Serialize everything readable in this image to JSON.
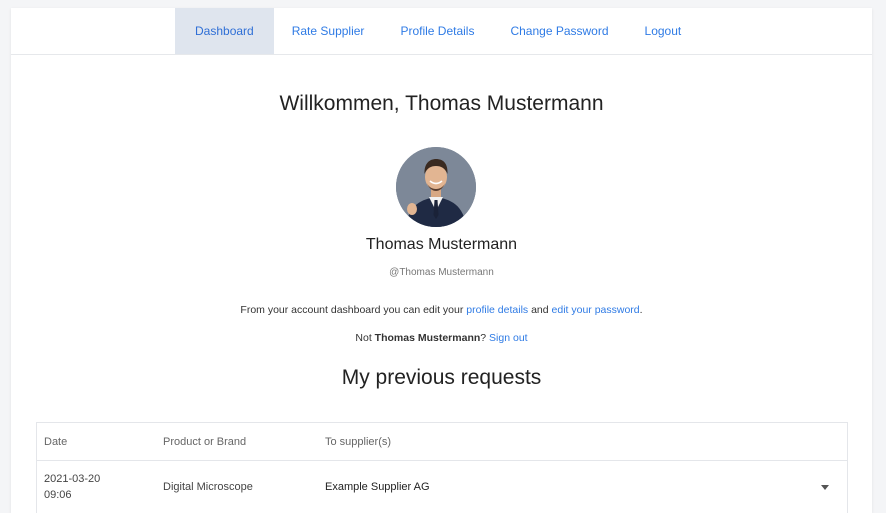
{
  "nav": {
    "items": [
      {
        "label": "Dashboard",
        "active": true
      },
      {
        "label": "Rate Supplier",
        "active": false
      },
      {
        "label": "Profile Details",
        "active": false
      },
      {
        "label": "Change Password",
        "active": false
      },
      {
        "label": "Logout",
        "active": false
      }
    ]
  },
  "welcome": "Willkommen, Thomas Mustermann",
  "profile": {
    "name": "Thomas Mustermann",
    "handle": "@Thomas Mustermann"
  },
  "info": {
    "prefix": "From your account dashboard you can edit your ",
    "profile_link": "profile details",
    "and": " and ",
    "password_link": "edit your password",
    "suffix": "."
  },
  "signout": {
    "prefix": "Not ",
    "name": "Thomas Mustermann",
    "question": "? ",
    "link": "Sign out"
  },
  "requests": {
    "title": "My previous requests",
    "columns": [
      "Date",
      "Product or Brand",
      "To supplier(s)"
    ],
    "rows": [
      {
        "date_line1": "2021-03-20",
        "date_line2": "09:06",
        "product": "Digital Microscope",
        "supplier": "Example Supplier AG",
        "expand_icon": "caret-down-icon"
      }
    ]
  },
  "colors": {
    "link": "#2f7be5",
    "active_tab_bg": "#dfe5ee"
  }
}
